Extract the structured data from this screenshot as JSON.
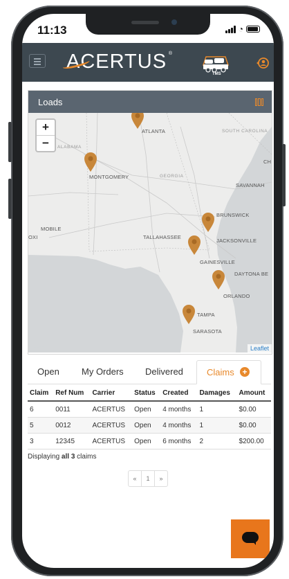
{
  "status_bar": {
    "time": "11:13"
  },
  "app_bar": {
    "brand": "ACERTUS",
    "reg_mark": "®",
    "tms_label": "TMS"
  },
  "loads_card": {
    "title": "Loads",
    "map": {
      "zoom_in": "+",
      "zoom_out": "−",
      "attribution": "Leaflet",
      "cities": [
        "ATLANTA",
        "MONTGOMERY",
        "SAVANNAH",
        "BRUNSWICK",
        "MOBILE",
        "TALLAHASSEE",
        "JACKSONVILLE",
        "GAINESVILLE",
        "DAYTONA BE",
        "ORLANDO",
        "TAMPA",
        "SARASOTA",
        "CH",
        "OXI"
      ],
      "states": [
        "SOUTH CAROLINA",
        "ALABAMA",
        "GEORGIA"
      ]
    }
  },
  "tabs": [
    {
      "label": "Open"
    },
    {
      "label": "My Orders"
    },
    {
      "label": "Delivered"
    },
    {
      "label": "Claims",
      "active": true
    }
  ],
  "claims_table": {
    "headers": [
      "Claim",
      "Ref Num",
      "Carrier",
      "Status",
      "Created",
      "Damages",
      "Amount"
    ],
    "rows": [
      [
        "6",
        "0011",
        "ACERTUS",
        "Open",
        "4 months",
        "1",
        "$0.00"
      ],
      [
        "5",
        "0012",
        "ACERTUS",
        "Open",
        "4 months",
        "1",
        "$0.00"
      ],
      [
        "3",
        "12345",
        "ACERTUS",
        "Open",
        "6 months",
        "2",
        "$200.00"
      ]
    ]
  },
  "summary": {
    "prefix": "Displaying ",
    "bold": "all 3",
    "suffix": " claims"
  },
  "pagination": {
    "prev": "«",
    "page": "1",
    "next": "»"
  },
  "colors": {
    "accent": "#e8892b",
    "header": "#3d4850",
    "card_header": "#5a6570"
  }
}
